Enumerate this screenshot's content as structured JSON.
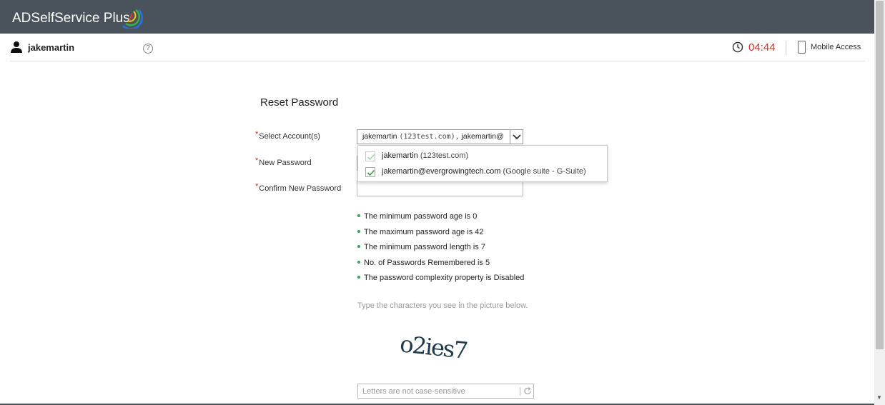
{
  "header": {
    "brand": "ADSelfService Plus",
    "colors": {
      "bar": "#4a535b",
      "arc_blue": "#2a6fdb",
      "arc_green": "#34b24a",
      "arc_yellow": "#f5c518",
      "arc_red": "#e03b2c"
    }
  },
  "userbar": {
    "username": "jakemartin",
    "help": "?",
    "timer": "04:44",
    "mobile_access": "Mobile Access",
    "colors": {
      "timer": "#d0312d"
    }
  },
  "form": {
    "title": "Reset Password",
    "select_label": "Select Account(s)",
    "new_password_label": "New Password",
    "confirm_label": "Confirm New Password",
    "required_mark": "*",
    "select_value_name": "jakemartin",
    "select_value_domain": "(123test.com),",
    "select_value_name2": "jakemartin@",
    "dropdown": [
      {
        "label": "jakemartin",
        "sub": "(123test.com)",
        "checked": true
      },
      {
        "label": "jakemartin@evergrowingtech.com",
        "sub": "(Google suite - G-Suite)",
        "checked": true
      }
    ]
  },
  "policies": [
    "The minimum password age is 0",
    "The maximum password age is 42",
    "The minimum password length is 7",
    "No. of Passwords Remembered is 5",
    "The password complexity property is Disabled"
  ],
  "captcha": {
    "hint": "Type the characters you see in the picture below.",
    "text": "o2ies7",
    "placeholder": "Letters are not case-sensitive"
  }
}
